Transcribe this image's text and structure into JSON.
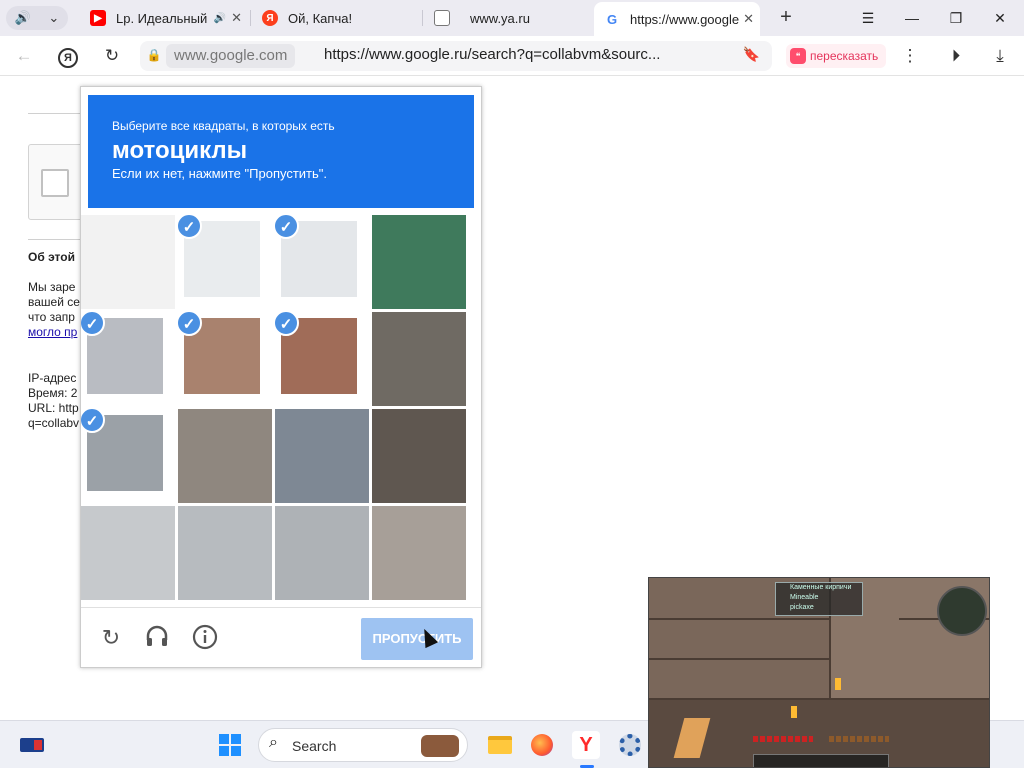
{
  "tabs": [
    {
      "title": "Lp. Идеальный",
      "favicon": "youtube-icon",
      "color": "#ff0000",
      "audio": true
    },
    {
      "title": "Ой, Капча!",
      "favicon": "yandex-icon",
      "color": "#fc3f1d",
      "audio": false
    },
    {
      "title": "www.ya.ru",
      "favicon": "document-icon",
      "color": "#666666",
      "audio": false
    },
    {
      "title": "https://www.google",
      "favicon": "google-icon",
      "color": "#4285f4",
      "audio": false,
      "active": true
    }
  ],
  "address_bar": {
    "host": "www.google.com",
    "url": "https://www.google.ru/search?q=collabvm&sourc...",
    "retell_label": "пересказать"
  },
  "page": {
    "about_title": "Об этой",
    "about_lines": [
      "Мы заре",
      "вашей се",
      "что запр"
    ],
    "about_link": "могло пр",
    "info_lines": [
      "IP-адрес",
      "Время: 2",
      "URL: http",
      "q=collabv"
    ]
  },
  "captcha": {
    "subtitle": "Выберите все квадраты, в которых есть",
    "object": "мотоциклы",
    "hint": "Если их нет, нажмите \"Пропустить\".",
    "skip_label": "ПРОПУСТИТЬ",
    "header_color": "#1a73e8",
    "tiles": [
      {
        "selected": false,
        "color": "#f2f2f2"
      },
      {
        "selected": true,
        "color": "#e9ecee"
      },
      {
        "selected": true,
        "color": "#e4e7ea"
      },
      {
        "selected": false,
        "color": "#3f7a5c"
      },
      {
        "selected": true,
        "color": "#b9bcc2"
      },
      {
        "selected": true,
        "color": "#a9826e"
      },
      {
        "selected": true,
        "color": "#a06c58"
      },
      {
        "selected": false,
        "color": "#6f6a63"
      },
      {
        "selected": true,
        "color": "#9ba1a7"
      },
      {
        "selected": false,
        "color": "#8f877f"
      },
      {
        "selected": false,
        "color": "#7e8894"
      },
      {
        "selected": false,
        "color": "#5f5750"
      },
      {
        "selected": false,
        "color": "#c6c9cc"
      },
      {
        "selected": false,
        "color": "#b7bbbf"
      },
      {
        "selected": false,
        "color": "#aeb2b6"
      },
      {
        "selected": false,
        "color": "#a79f98"
      }
    ]
  },
  "taskbar": {
    "search_label": "Search",
    "apps": [
      "widgets-icon",
      "windows-start-icon",
      "file-explorer-icon",
      "firefox-icon",
      "yandex-browser-icon",
      "settings-icon"
    ]
  },
  "game_overlay": {
    "panel_lines": [
      "Каменные кирпичи",
      "Mineable",
      "pickaxe"
    ]
  }
}
